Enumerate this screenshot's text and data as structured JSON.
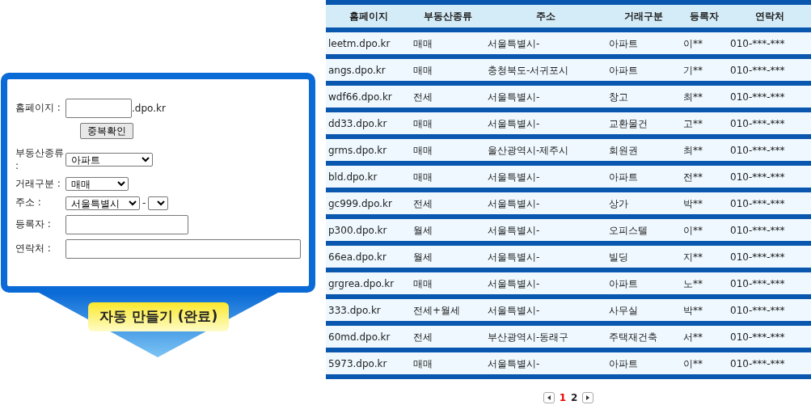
{
  "form": {
    "fields": [
      {
        "kind": "text",
        "label": "홈페이지 :",
        "suffix": ".dpo.kr",
        "button": "중복확인"
      },
      {
        "kind": "select",
        "label": "부동산종류 :",
        "value": "아파트"
      },
      {
        "kind": "select",
        "label": "거래구분 :",
        "value": "매매"
      },
      {
        "kind": "select",
        "label": "주소 :",
        "value": "서울특별시",
        "separator": "-",
        "second_select": true
      },
      {
        "kind": "text",
        "label": "등록자 :"
      },
      {
        "kind": "text",
        "label": "연락처 :"
      }
    ],
    "submit": "자동 만들기 (완료)"
  },
  "table": {
    "columns": [
      "홈페이지",
      "부동산종류",
      "주소",
      "거래구분",
      "등록자",
      "연락처"
    ],
    "rows": [
      [
        "leetm.dpo.kr",
        "매매",
        "서울특별시-",
        "아파트",
        "이**",
        "010-***-***"
      ],
      [
        "angs.dpo.kr",
        "매매",
        "충청북도-서귀포시",
        "아파트",
        "기**",
        "010-***-***"
      ],
      [
        "wdf66.dpo.kr",
        "전세",
        "서울특별시-",
        "창고",
        "최**",
        "010-***-***"
      ],
      [
        "dd33.dpo.kr",
        "매매",
        "서울특별시-",
        "교환물건",
        "고**",
        "010-***-***"
      ],
      [
        "grms.dpo.kr",
        "매매",
        "울산광역시-제주시",
        "회원권",
        "최**",
        "010-***-***"
      ],
      [
        "bld.dpo.kr",
        "매매",
        "서울특별시-",
        "아파트",
        "전**",
        "010-***-***"
      ],
      [
        "gc999.dpo.kr",
        "전세",
        "서울특별시-",
        "상가",
        "박**",
        "010-***-***"
      ],
      [
        "p300.dpo.kr",
        "월세",
        "서울특별시-",
        "오피스텔",
        "이**",
        "010-***-***"
      ],
      [
        "66ea.dpo.kr",
        "월세",
        "서울특별시-",
        "빌딩",
        "지**",
        "010-***-***"
      ],
      [
        "grgrea.dpo.kr",
        "매매",
        "서울특별시-",
        "아파트",
        "노**",
        "010-***-***"
      ],
      [
        "333.dpo.kr",
        "전세+월세",
        "서울특별시-",
        "사무실",
        "박**",
        "010-***-***"
      ],
      [
        "60md.dpo.kr",
        "전세",
        "부산광역시-동래구",
        "주택재건축",
        "서**",
        "010-***-***"
      ],
      [
        "5973.dpo.kr",
        "매매",
        "서울특별시-",
        "아파트",
        "이**",
        "010-***-***"
      ]
    ]
  },
  "pagination": {
    "pages": [
      {
        "label": "1",
        "selected": true
      },
      {
        "label": "2",
        "selected": false
      }
    ]
  }
}
